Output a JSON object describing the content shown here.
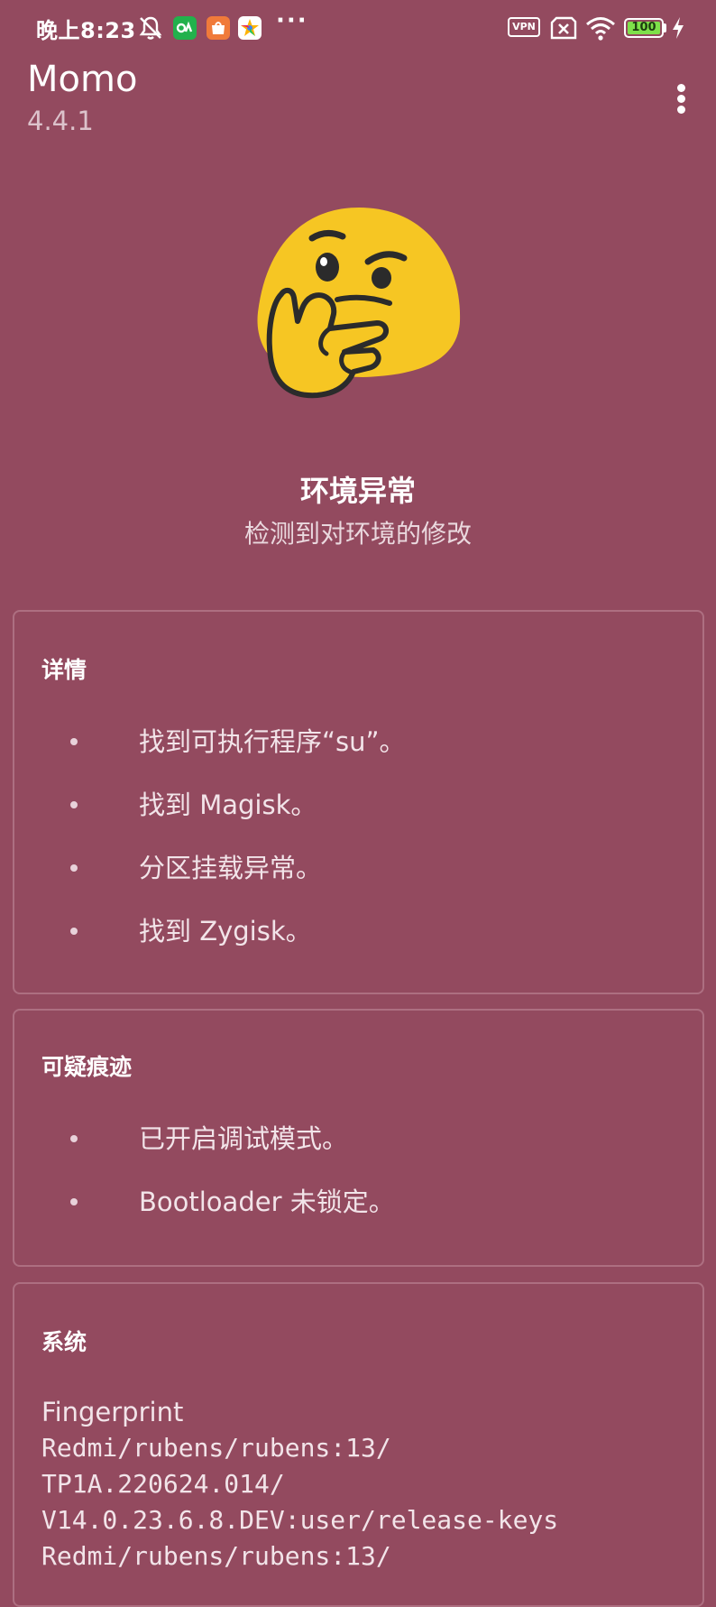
{
  "status_bar": {
    "time": "晚上8:23",
    "more_indicator": "···",
    "vpn_label": "VPN",
    "battery_percent": "100",
    "battery_level": 1.0,
    "icons": [
      "muted-bell-icon",
      "app-notification-icon-green",
      "app-notification-icon-orange",
      "app-notification-icon-multicolor",
      "vpn-icon",
      "no-sim-icon",
      "wifi-icon",
      "battery-icon",
      "charging-bolt-icon"
    ]
  },
  "app_bar": {
    "title": "Momo",
    "version": "4.4.1",
    "menu_icon": "overflow-menu-icon"
  },
  "hero": {
    "emoji": "thinking-face-emoji",
    "title": "环境异常",
    "subtitle": "检测到对环境的修改"
  },
  "details_card": {
    "title": "详情",
    "items": [
      "找到可执行程序“su”。",
      "找到 Magisk。",
      "分区挂载异常。",
      "找到 Zygisk。"
    ]
  },
  "suspicious_card": {
    "title": "可疑痕迹",
    "items": [
      "已开启调试模式。",
      "Bootloader 未锁定。"
    ]
  },
  "system_card": {
    "title": "系统",
    "fingerprint_label": "Fingerprint",
    "fingerprint_lines": [
      "Redmi/rubens/rubens:13/",
      "TP1A.220624.014/",
      "V14.0.23.6.8.DEV:user/release-keys",
      "Redmi/rubens/rubens:13/"
    ]
  },
  "colors": {
    "background": "#934a5f",
    "card_border": "#ad6f81",
    "emoji_yellow": "#f6c623",
    "battery_green": "#7ee04a"
  }
}
